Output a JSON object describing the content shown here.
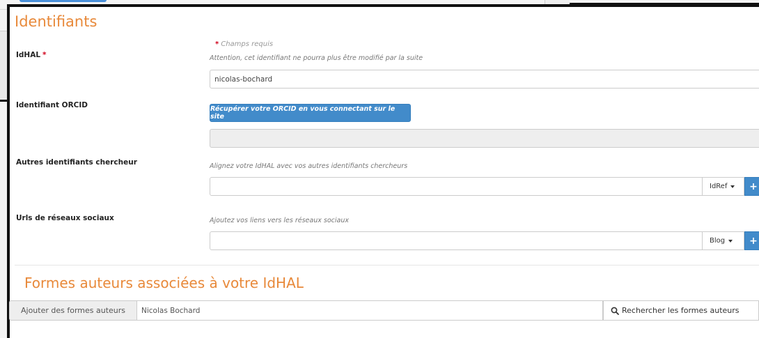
{
  "identifiants": {
    "title": "Identifiants",
    "required_star": "*",
    "required_note": "Champs requis"
  },
  "idhal": {
    "label": "IdHAL",
    "star": "*",
    "help": "Attention, cet identifiant ne pourra plus être modifié par la suite",
    "value": "nicolas-bochard"
  },
  "orcid": {
    "label": "Identifiant ORCID",
    "button": "Récupérer votre ORCID en vous connectant sur le site",
    "value": ""
  },
  "autres": {
    "label": "Autres identifiants chercheur",
    "help": "Alignez votre IdHAL avec vos autres identifiants chercheurs",
    "value": "",
    "dropdown": "IdRef",
    "add": "+"
  },
  "reseaux": {
    "label": "Urls de réseaux sociaux",
    "help": "Ajoutez vos liens vers les réseaux sociaux",
    "value": "",
    "dropdown": "Blog",
    "add": "+"
  },
  "formes": {
    "title": "Formes auteurs associées à votre IdHAL",
    "addon": "Ajouter des formes auteurs",
    "value": "Nicolas Bochard",
    "search": "Rechercher les formes auteurs",
    "search_icon": "search-icon"
  },
  "colors": {
    "accent": "#e8893a",
    "primary": "#428bca",
    "required": "#d0021b"
  }
}
